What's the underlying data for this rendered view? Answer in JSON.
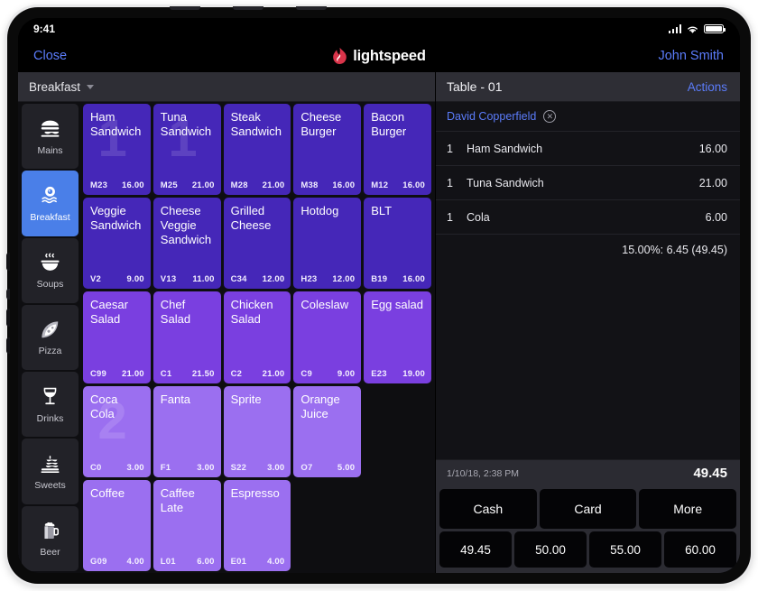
{
  "status_bar": {
    "time": "9:41",
    "signal_icon": "signal-bars-icon",
    "wifi_icon": "wifi-icon",
    "battery_icon": "battery-icon"
  },
  "nav": {
    "close_label": "Close",
    "brand_name": "lightspeed",
    "brand_icon": "lightspeed-flame-logo",
    "user_name": "John Smith"
  },
  "category_bar": {
    "label": "Breakfast",
    "caret_icon": "chevron-down-icon"
  },
  "sidebar": {
    "items": [
      {
        "label": "Mains",
        "icon": "burger-icon",
        "active": false
      },
      {
        "label": "Breakfast",
        "icon": "fried-egg-icon",
        "active": true
      },
      {
        "label": "Soups",
        "icon": "soup-bowl-icon",
        "active": false
      },
      {
        "label": "Pizza",
        "icon": "pizza-slice-icon",
        "active": false
      },
      {
        "label": "Drinks",
        "icon": "wine-glass-icon",
        "active": false
      },
      {
        "label": "Sweets",
        "icon": "cake-icon",
        "active": false
      },
      {
        "label": "Beer",
        "icon": "beer-mug-icon",
        "active": false
      }
    ]
  },
  "colors": {
    "tile_dark_purple": "#4527b8",
    "tile_mid_purple": "#7a3fe0",
    "tile_light_purple": "#9b6ff0",
    "accent_blue": "#5b7cfa",
    "active_sidebar_blue": "#4a7fe8",
    "brand_red": "#d9344a"
  },
  "products": [
    {
      "name": "Ham Sandwich",
      "sku": "M23",
      "price": "16.00",
      "shade": "dark",
      "badge": "1"
    },
    {
      "name": "Tuna Sandwich",
      "sku": "M25",
      "price": "21.00",
      "shade": "dark",
      "badge": "1"
    },
    {
      "name": "Steak Sandwich",
      "sku": "M28",
      "price": "21.00",
      "shade": "dark",
      "badge": ""
    },
    {
      "name": "Cheese Burger",
      "sku": "M38",
      "price": "16.00",
      "shade": "dark",
      "badge": ""
    },
    {
      "name": "Bacon Burger",
      "sku": "M12",
      "price": "16.00",
      "shade": "dark",
      "badge": ""
    },
    {
      "name": "Veggie Sandwich",
      "sku": "V2",
      "price": "9.00",
      "shade": "dark",
      "badge": ""
    },
    {
      "name": "Cheese Veggie Sandwich",
      "sku": "V13",
      "price": "11.00",
      "shade": "dark",
      "badge": ""
    },
    {
      "name": "Grilled Cheese",
      "sku": "C34",
      "price": "12.00",
      "shade": "dark",
      "badge": ""
    },
    {
      "name": "Hotdog",
      "sku": "H23",
      "price": "12.00",
      "shade": "dark",
      "badge": ""
    },
    {
      "name": "BLT",
      "sku": "B19",
      "price": "16.00",
      "shade": "dark",
      "badge": ""
    },
    {
      "name": "Caesar Salad",
      "sku": "C99",
      "price": "21.00",
      "shade": "mid",
      "badge": ""
    },
    {
      "name": "Chef Salad",
      "sku": "C1",
      "price": "21.50",
      "shade": "mid",
      "badge": ""
    },
    {
      "name": "Chicken Salad",
      "sku": "C2",
      "price": "21.00",
      "shade": "mid",
      "badge": ""
    },
    {
      "name": "Coleslaw",
      "sku": "C9",
      "price": "9.00",
      "shade": "mid",
      "badge": ""
    },
    {
      "name": "Egg salad",
      "sku": "E23",
      "price": "19.00",
      "shade": "mid",
      "badge": ""
    },
    {
      "name": "Coca Cola",
      "sku": "C0",
      "price": "3.00",
      "shade": "light",
      "badge": "2"
    },
    {
      "name": "Fanta",
      "sku": "F1",
      "price": "3.00",
      "shade": "light",
      "badge": ""
    },
    {
      "name": "Sprite",
      "sku": "S22",
      "price": "3.00",
      "shade": "light",
      "badge": ""
    },
    {
      "name": "Orange Juice",
      "sku": "O7",
      "price": "5.00",
      "shade": "light",
      "badge": ""
    },
    {
      "name": "",
      "sku": "",
      "price": "",
      "shade": "empty",
      "badge": ""
    },
    {
      "name": "Coffee",
      "sku": "G09",
      "price": "4.00",
      "shade": "light",
      "badge": ""
    },
    {
      "name": "Caffee Late",
      "sku": "L01",
      "price": "6.00",
      "shade": "light",
      "badge": ""
    },
    {
      "name": "Espresso",
      "sku": "E01",
      "price": "4.00",
      "shade": "light",
      "badge": ""
    },
    {
      "name": "",
      "sku": "",
      "price": "",
      "shade": "empty",
      "badge": ""
    },
    {
      "name": "",
      "sku": "",
      "price": "",
      "shade": "empty",
      "badge": ""
    }
  ],
  "order": {
    "table_title": "Table - 01",
    "actions_label": "Actions",
    "customer_name": "David Copperfield",
    "customer_remove_icon": "remove-customer-icon",
    "lines": [
      {
        "qty": "1",
        "name": "Ham Sandwich",
        "price": "16.00"
      },
      {
        "qty": "1",
        "name": "Tuna Sandwich",
        "price": "21.00"
      },
      {
        "qty": "1",
        "name": "Cola",
        "price": "6.00"
      }
    ],
    "discount_line": "15.00%: 6.45 (49.45)",
    "timestamp": "1/10/18, 2:38 PM",
    "total": "49.45"
  },
  "payment": {
    "methods": [
      "Cash",
      "Card",
      "More"
    ],
    "amounts": [
      "49.45",
      "50.00",
      "55.00",
      "60.00"
    ]
  }
}
